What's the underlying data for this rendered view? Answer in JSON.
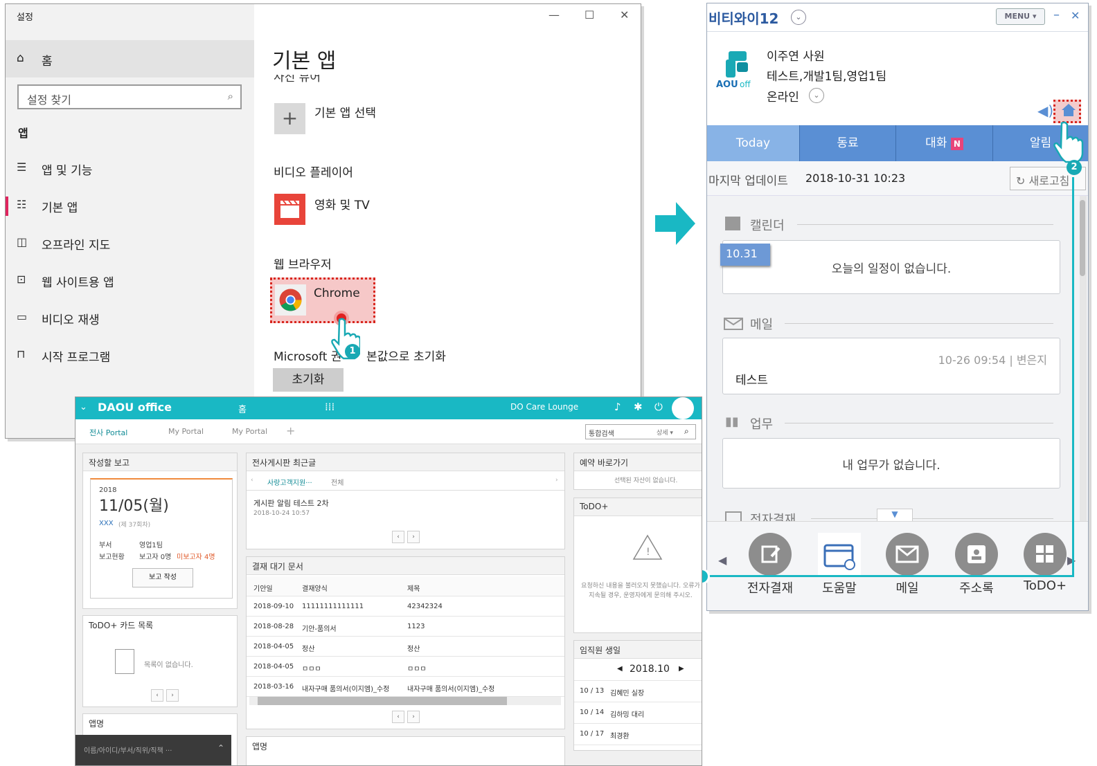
{
  "settings": {
    "window_title": "설정",
    "minimize": "—",
    "maximize": "☐",
    "close": "✕",
    "home": "홈",
    "search_placeholder": "설정 찾기",
    "section": "앱",
    "nav": [
      "앱 및 기능",
      "기본 앱",
      "오프라인 지도",
      "웹 사이트용 앱",
      "비디오 재생",
      "시작 프로그램"
    ],
    "page_title": "기본 앱",
    "partial_heading": "사진 뷰어",
    "choose_default": "기본 앱 선택",
    "video_heading": "비디오 플레이어",
    "video_app": "영화 및 TV",
    "browser_heading": "웹 브라우저",
    "browser_app": "Chrome",
    "reset_prefix": "Microsoft 권",
    "reset_suffix": "본값으로 초기화",
    "reset_button": "초기화",
    "step1": "1"
  },
  "messenger": {
    "title": "비티와이12",
    "menu": "MENU",
    "minimize": "–",
    "close": "✕",
    "user_name": "이주연 사원",
    "user_dept": "테스트,개발1팀,영업1팀",
    "status": "온라인",
    "tabs": [
      "Today",
      "동료",
      "대화",
      "알림"
    ],
    "new_badge": "N",
    "update_label": "마지막 업데이트",
    "update_time": "2018-10-31  10:23",
    "refresh": "새로고침",
    "step2": "2",
    "calendar_title": "캘린더",
    "calendar_date": "10.31",
    "calendar_empty": "오늘의 일정이 없습니다.",
    "mail_title": "메일",
    "mail_meta": "10-26  09:54  |  변은지",
    "mail_subject": "테스트",
    "task_title": "업무",
    "task_empty": "내 업무가 없습니다.",
    "approval_title": "전자결재",
    "dock": [
      "전자결재",
      "도움말",
      "메일",
      "주소록",
      "ToDO+"
    ]
  },
  "daou": {
    "logo": "DAOU office",
    "home_tab": "홈",
    "care": "DO Care Lounge",
    "subtabs": [
      "전사 Portal",
      "My Portal",
      "My Portal"
    ],
    "search_placeholder": "통합검색",
    "search_detail": "상세 ▾",
    "report": {
      "title": "작성할 보고",
      "year": "2018",
      "date": "11/05(월)",
      "name": "XXX",
      "round": "(제 37회차)",
      "dept_label": "부서",
      "dept": "영업1팀",
      "status_label": "보고현황",
      "status": "보고자 0명",
      "unreported": "미보고자 4명",
      "button": "보고 작성"
    },
    "todo": {
      "title": "ToDO+ 카드 목록",
      "empty": "목록이 없습니다."
    },
    "left_bottom": "앱명",
    "dock_search": "이름/아이디/부서/직위/직책 ···",
    "board": {
      "title": "전사게시판 최근글",
      "tab1": "사랑고객지원···",
      "tab2": "전체",
      "post_title": "게시판 알림 테스트 2차",
      "post_time": "2018-10-24 10:57"
    },
    "approval": {
      "title": "결재 대기 문서",
      "headers": [
        "기안일",
        "결재양식",
        "제목"
      ],
      "rows": [
        [
          "2018-09-10",
          "11111111111111",
          "42342324"
        ],
        [
          "2018-08-28",
          "기안-품의서",
          "1123"
        ],
        [
          "2018-04-05",
          "정산",
          "정산"
        ],
        [
          "2018-04-05",
          "ㅁㅁㅁ",
          "ㅁㅁㅁ"
        ],
        [
          "2018-03-16",
          "내자구매 품의서(이지엠)_수정",
          "내자구매 품의서(이지엠)_수정"
        ]
      ]
    },
    "mid_bottom": "앱명",
    "reservation": {
      "title": "예약 바로가기",
      "empty": "선택된 자산이 없습니다."
    },
    "todo_plus": {
      "title": "ToDO+",
      "error": "요청하신 내용을 불러오지 못했습니다. 오류가 지속될 경우, 운영자에게 문의해 주시오."
    },
    "birthday": {
      "title": "임직원 생일",
      "month": "2018.10",
      "rows": [
        [
          "10 / 13",
          "김혜민 실장"
        ],
        [
          "10 / 14",
          "김하밍 대리"
        ],
        [
          "10 / 17",
          "최경환"
        ]
      ]
    }
  }
}
